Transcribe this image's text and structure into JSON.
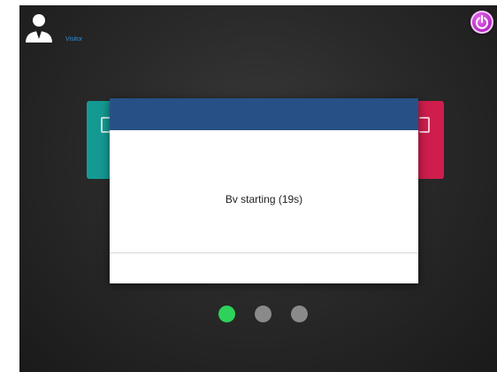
{
  "header": {
    "user_label": "Visitor",
    "user_icon": "user-avatar-icon",
    "power_icon": "power-icon",
    "power_color": "#b52cc4"
  },
  "background_tiles": [
    {
      "name": "tile-left",
      "color": "#159a93"
    },
    {
      "name": "tile-right",
      "color": "#cf1d4d"
    }
  ],
  "dialog": {
    "header_color": "#275186",
    "message": "Bv starting (19s)"
  },
  "pager": {
    "active_index": 0,
    "count": 3,
    "active_color": "#2ed15a",
    "inactive_color": "#8a8a8a"
  }
}
